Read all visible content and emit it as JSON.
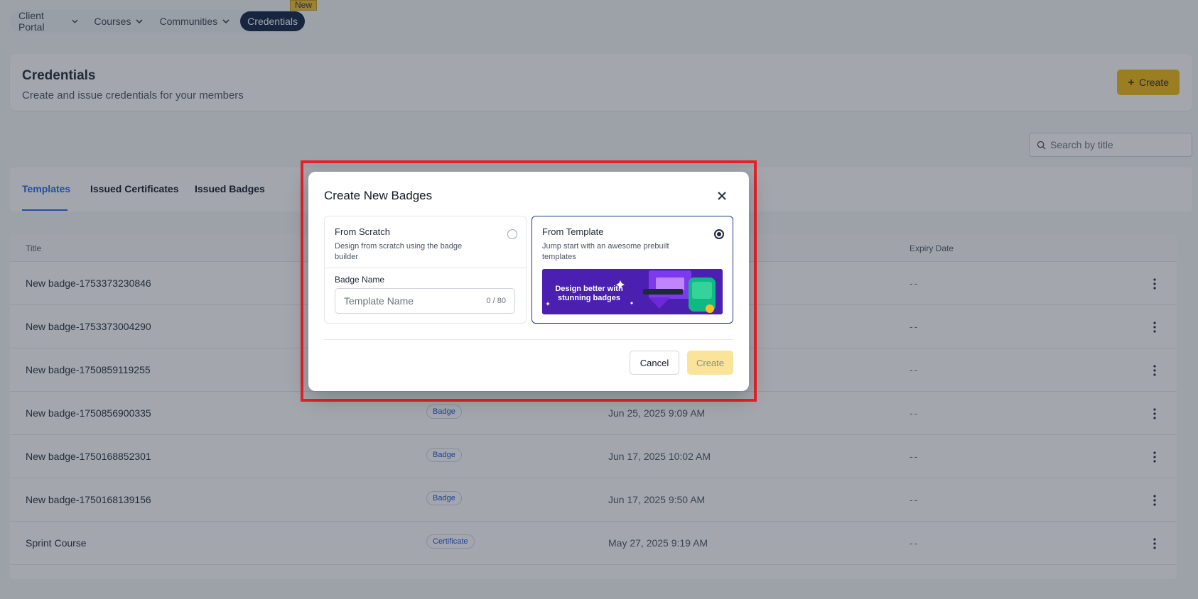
{
  "nav": {
    "items": [
      "Client Portal",
      "Courses",
      "Communities"
    ],
    "active": "Credentials",
    "new_badge": "New"
  },
  "header": {
    "title": "Credentials",
    "subtitle": "Create and issue credentials for your members",
    "create_label": "Create"
  },
  "search": {
    "placeholder": "Search by title"
  },
  "tabs": [
    "Templates",
    "Issued Certificates",
    "Issued Badges"
  ],
  "table": {
    "columns": {
      "title": "Title",
      "expiry": "Expiry Date"
    },
    "rows": [
      {
        "title": "New badge-1753373230846",
        "type": "",
        "created": "",
        "expiry": "--"
      },
      {
        "title": "New badge-1753373004290",
        "type": "",
        "created": "",
        "expiry": "--"
      },
      {
        "title": "New badge-1750859119255",
        "type": "",
        "created": "",
        "expiry": "--"
      },
      {
        "title": "New badge-1750856900335",
        "type": "Badge",
        "created": "Jun 25, 2025 9:09 AM",
        "expiry": "--"
      },
      {
        "title": "New badge-1750168852301",
        "type": "Badge",
        "created": "Jun 17, 2025 10:02 AM",
        "expiry": "--"
      },
      {
        "title": "New badge-1750168139156",
        "type": "Badge",
        "created": "Jun 17, 2025 9:50 AM",
        "expiry": "--"
      },
      {
        "title": "Sprint Course",
        "type": "Certificate",
        "created": "May 27, 2025 9:19 AM",
        "expiry": "--"
      }
    ]
  },
  "modal": {
    "title": "Create New Badges",
    "from_scratch": {
      "title": "From Scratch",
      "desc": "Design from scratch using the badge builder",
      "badge_name_label": "Badge Name",
      "input_placeholder": "Template Name",
      "counter": "0 / 80"
    },
    "from_template": {
      "title": "From Template",
      "desc": "Jump start with an awesome prebuilt templates",
      "promo_text": "Design better with stunning badges"
    },
    "cancel_label": "Cancel",
    "create_label": "Create"
  }
}
